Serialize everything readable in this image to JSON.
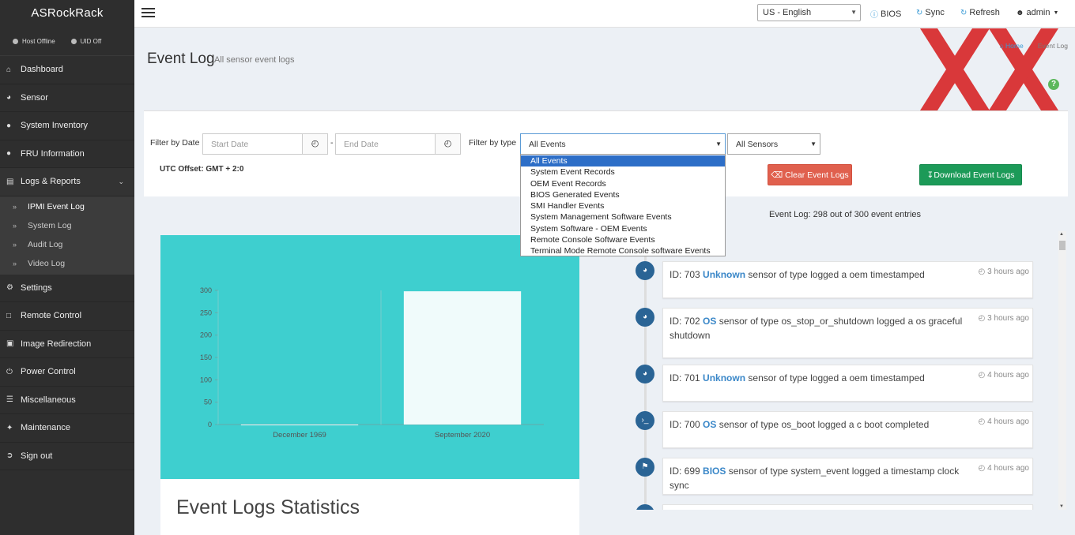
{
  "brand": "ASRockRack",
  "status": {
    "host": "Host Offline",
    "uid": "UID Off"
  },
  "sidebar": {
    "items": [
      {
        "label": "Dashboard",
        "icon": "dashboard-icon"
      },
      {
        "label": "Sensor",
        "icon": "gauge-icon"
      },
      {
        "label": "System Inventory",
        "icon": "info-icon"
      },
      {
        "label": "FRU Information",
        "icon": "info-icon"
      },
      {
        "label": "Logs & Reports",
        "icon": "bar-chart-icon"
      },
      {
        "label": "Settings",
        "icon": "gear-icon"
      },
      {
        "label": "Remote Control",
        "icon": "monitor-icon"
      },
      {
        "label": "Image Redirection",
        "icon": "drive-icon"
      },
      {
        "label": "Power Control",
        "icon": "power-icon"
      },
      {
        "label": "Miscellaneous",
        "icon": "list-icon"
      },
      {
        "label": "Maintenance",
        "icon": "wrench-icon"
      },
      {
        "label": "Sign out",
        "icon": "sign-out-icon"
      }
    ],
    "sub": [
      "IPMI Event Log",
      "System Log",
      "Audit Log",
      "Video Log"
    ]
  },
  "topbar": {
    "language": "US - English",
    "bios": "BIOS",
    "sync": "Sync",
    "refresh": "Refresh",
    "user": "admin"
  },
  "page": {
    "title": "Event Log",
    "subtitle": "All sensor event logs",
    "breadcrumb_home": "Home",
    "breadcrumb_current": "Event Log"
  },
  "filter": {
    "date_label": "Filter by Date",
    "start_placeholder": "Start Date",
    "end_placeholder": "End Date",
    "separator": "-",
    "type_label": "Filter by type",
    "type_selected": "All Events",
    "sensor_selected": "All Sensors",
    "utc_offset": "UTC Offset: GMT + 2:0",
    "clear_label": "Clear Event Logs",
    "download_label": "Download Event Logs",
    "type_options": [
      "All Events",
      "System Event Records",
      "OEM Event Records",
      "BIOS Generated Events",
      "SMI Handler Events",
      "System Management Software Events",
      "System Software - OEM Events",
      "Remote Console Software Events",
      "Terminal Mode Remote Console software Events"
    ]
  },
  "count_text": "Event Log: 298 out of 300 event entries",
  "chart_data": {
    "type": "bar",
    "categories": [
      "December 1969",
      "September 2020"
    ],
    "values": [
      0,
      298
    ],
    "ylim": [
      0,
      300
    ],
    "yticks": [
      0,
      50,
      100,
      150,
      200,
      250,
      300
    ],
    "title": "",
    "xlabel": "",
    "ylabel": "",
    "colors": {
      "background": "#3ecfcf",
      "bar": "#f0fbfb"
    }
  },
  "stats_title": "Event Logs Statistics",
  "events": [
    {
      "id": "ID: 703",
      "source": "Unknown",
      "message": "sensor of type logged a oem timestamped",
      "time": "3 hours ago",
      "icon": "gauge-icon"
    },
    {
      "id": "ID: 702",
      "source": "OS",
      "message": "sensor of type os_stop_or_shutdown logged a os graceful shutdown",
      "time": "3 hours ago",
      "icon": "gauge-icon"
    },
    {
      "id": "ID: 701",
      "source": "Unknown",
      "message": "sensor of type logged a oem timestamped",
      "time": "4 hours ago",
      "icon": "gauge-icon"
    },
    {
      "id": "ID: 700",
      "source": "OS",
      "message": "sensor of type os_boot logged a c boot completed",
      "time": "4 hours ago",
      "icon": "terminal-icon"
    },
    {
      "id": "ID: 699",
      "source": "BIOS",
      "message": "sensor of type system_event logged a timestamp clock sync",
      "time": "4 hours ago",
      "icon": "flag-icon"
    }
  ]
}
